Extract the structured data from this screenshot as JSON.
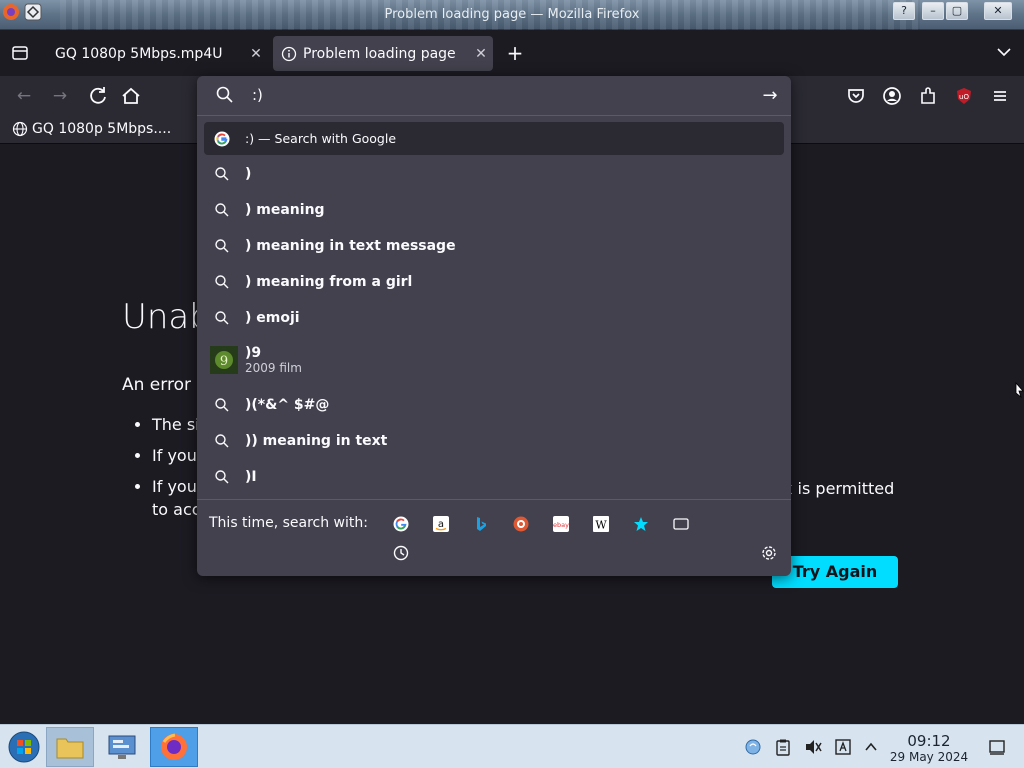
{
  "window": {
    "title": "Problem loading page — Mozilla Firefox"
  },
  "tabs": [
    {
      "label": "GQ 1080p 5Mbps.mp4U",
      "active": false
    },
    {
      "label": "Problem loading page",
      "active": true
    }
  ],
  "bookmarks": [
    {
      "label": "GQ 1080p 5Mbps...."
    }
  ],
  "urlbar": {
    "value": ":)",
    "results": [
      {
        "text": ":) — Search with Google",
        "icon": "google-icon",
        "type": "search-with"
      },
      {
        "text": ")",
        "icon": "search-icon"
      },
      {
        "text": ") meaning",
        "icon": "search-icon"
      },
      {
        "text": ") meaning in text message",
        "icon": "search-icon"
      },
      {
        "text": ") meaning from a girl",
        "icon": "search-icon"
      },
      {
        "text": ") emoji",
        "icon": "search-icon"
      },
      {
        "text": ")9",
        "sub": "2009 film",
        "icon": "film-thumbnail"
      },
      {
        "text": ")(*&^ $#@",
        "icon": "search-icon"
      },
      {
        "text": ")) meaning in text",
        "icon": "search-icon"
      },
      {
        "text": ")I",
        "icon": "search-icon"
      }
    ],
    "oneoff_label": "This time, search with:",
    "engines": [
      "google-icon",
      "amazon-icon",
      "bing-icon",
      "duckduckgo-icon",
      "ebay-icon",
      "wikipedia-icon",
      "bookmarks-star-icon",
      "tabs-icon"
    ]
  },
  "error_page": {
    "title_visible": "Unab",
    "description_visible": "An error",
    "list_visible": [
      "The si",
      "If you",
      "If your"
    ],
    "line_tail_1": "x is permitted",
    "line_tail_2": "to acc",
    "try_again": "Try Again"
  },
  "taskbar": {
    "time": "09:12",
    "date": "29 May 2024"
  },
  "colors": {
    "accent": "#00ddff",
    "panel": "#42414d",
    "toolbar": "#2b2a33",
    "page": "#1c1b22"
  }
}
